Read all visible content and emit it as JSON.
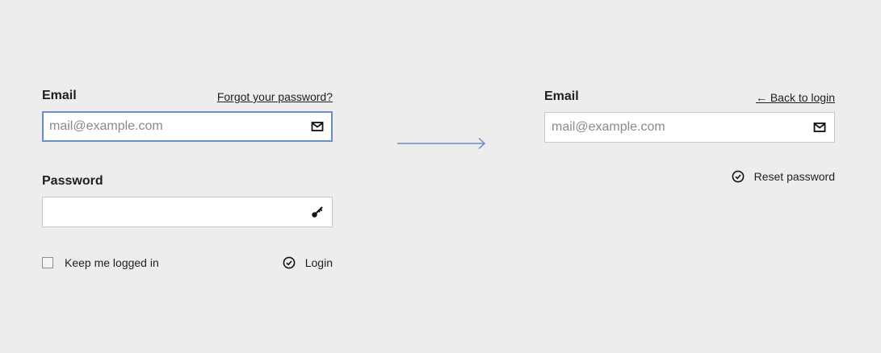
{
  "login": {
    "email_label": "Email",
    "forgot_link": "Forgot your password?",
    "email_placeholder": "mail@example.com",
    "password_label": "Password",
    "password_value": "",
    "keep_logged_in_label": "Keep me logged in",
    "keep_logged_in_checked": false,
    "login_button": "Login"
  },
  "reset": {
    "email_label": "Email",
    "back_link": "← Back to login",
    "email_placeholder": "mail@example.com",
    "reset_button": "Reset password"
  },
  "icons": {
    "email_field": "mail-icon",
    "password_field": "key-icon",
    "submit": "check-circle-icon",
    "flow": "arrow-right-icon"
  },
  "colors": {
    "background": "#ededed",
    "focus_border": "#6b8ec4",
    "flow_arrow": "#6b8ec4"
  }
}
